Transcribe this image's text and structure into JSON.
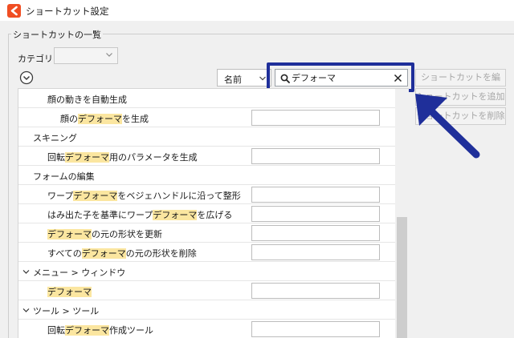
{
  "window": {
    "title": "ショートカット設定"
  },
  "group": {
    "label": "ショートカットの一覧"
  },
  "filters": {
    "category_label": "カテゴリー:",
    "category_value": "",
    "sort_value": "名前",
    "search_value": "デフォーマ"
  },
  "buttons": {
    "edit": "ショートカットを編集...",
    "add": "ショートカットを追加",
    "delete": "ショートカットを削除"
  },
  "rows": [
    {
      "type": "item",
      "pre": "顔の動きを自動生成",
      "hl": "",
      "post": "",
      "field": false
    },
    {
      "type": "item",
      "pre": "顔の",
      "hl": "デフォーマ",
      "post": "を生成",
      "field": true
    },
    {
      "type": "section",
      "pre": "スキニング",
      "hl": "",
      "post": "",
      "field": false
    },
    {
      "type": "item",
      "pre": "回転",
      "hl": "デフォーマ",
      "post": "用のパラメータを生成",
      "field": true
    },
    {
      "type": "section",
      "pre": "フォームの編集",
      "hl": "",
      "post": "",
      "field": false
    },
    {
      "type": "item",
      "pre": "ワープ",
      "hl": "デフォーマ",
      "post": "をベジェハンドルに沿って整形",
      "field": true
    },
    {
      "type": "item",
      "pre": "はみ出た子を基準にワープ",
      "hl": "デフォーマ",
      "post": "を広げる",
      "field": true
    },
    {
      "type": "item",
      "pre": "",
      "hl": "デフォーマ",
      "post": "の元の形状を更新",
      "field": true
    },
    {
      "type": "item",
      "pre": "すべての",
      "hl": "デフォーマ",
      "post": "の元の形状を削除",
      "field": true
    },
    {
      "type": "category",
      "pre": "メニュー > ウィンドウ",
      "hl": "",
      "post": "",
      "field": false
    },
    {
      "type": "item",
      "pre": "",
      "hl": "デフォーマ",
      "post": "",
      "field": true
    },
    {
      "type": "category",
      "pre": "ツール > ツール",
      "hl": "",
      "post": "",
      "field": false
    },
    {
      "type": "item",
      "pre": "回転",
      "hl": "デフォーマ",
      "post": "作成ツール",
      "field": true
    }
  ],
  "colors": {
    "highlight": "#fbe6a0",
    "annotation": "#1f2f9a",
    "logo": "#f04e23"
  }
}
